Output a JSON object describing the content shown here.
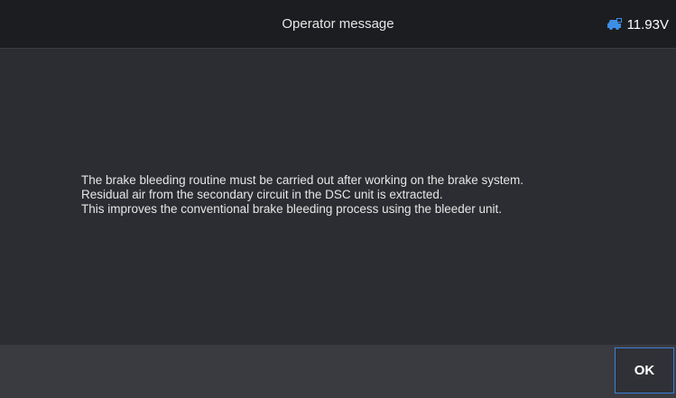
{
  "header": {
    "title": "Operator message",
    "voltage": "11.93V",
    "vehicle_icon": "car-battery-icon",
    "icon_color": "#3d8ee6"
  },
  "message": {
    "lines": [
      "The brake bleeding routine must be carried out after working on the brake system.",
      "Residual air from the secondary circuit in the DSC unit is extracted.",
      "This improves the conventional brake bleeding process using the bleeder unit."
    ]
  },
  "footer": {
    "ok_label": "OK",
    "accent": "#3d7fd6"
  }
}
